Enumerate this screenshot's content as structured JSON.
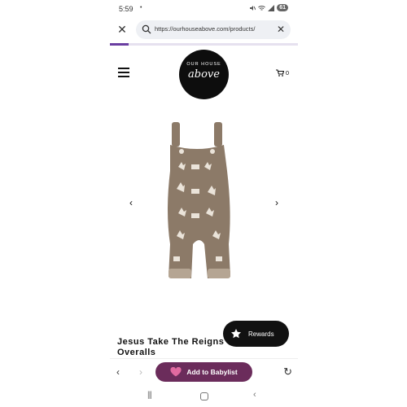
{
  "status_bar": {
    "time": "5:59",
    "dot": "•",
    "battery": "61"
  },
  "browser": {
    "url": "https://ourhouseabove.com/products/",
    "load_progress_fraction": 0.1,
    "babylist_label": "Add to Babylist"
  },
  "site": {
    "logo_top": "OUR HOUSE",
    "logo_script": "above",
    "cart_count": "0"
  },
  "product": {
    "title": "Jesus Take The Reigns Overalls",
    "image_color": "#8c7a68"
  },
  "rewards": {
    "label": "Rewards"
  },
  "colors": {
    "accent": "#6a3ea1",
    "babylist": "#6b2c5b",
    "heart": "#e06aa0"
  },
  "icons": {
    "close_tab": "close-icon",
    "search": "search-icon",
    "clear": "clear-icon",
    "menu": "menu-icon",
    "cart": "cart-icon",
    "prev": "chevron-left-icon",
    "next": "chevron-right-icon",
    "rewards": "star-icon",
    "heart": "heart-icon",
    "reload": "reload-icon"
  }
}
